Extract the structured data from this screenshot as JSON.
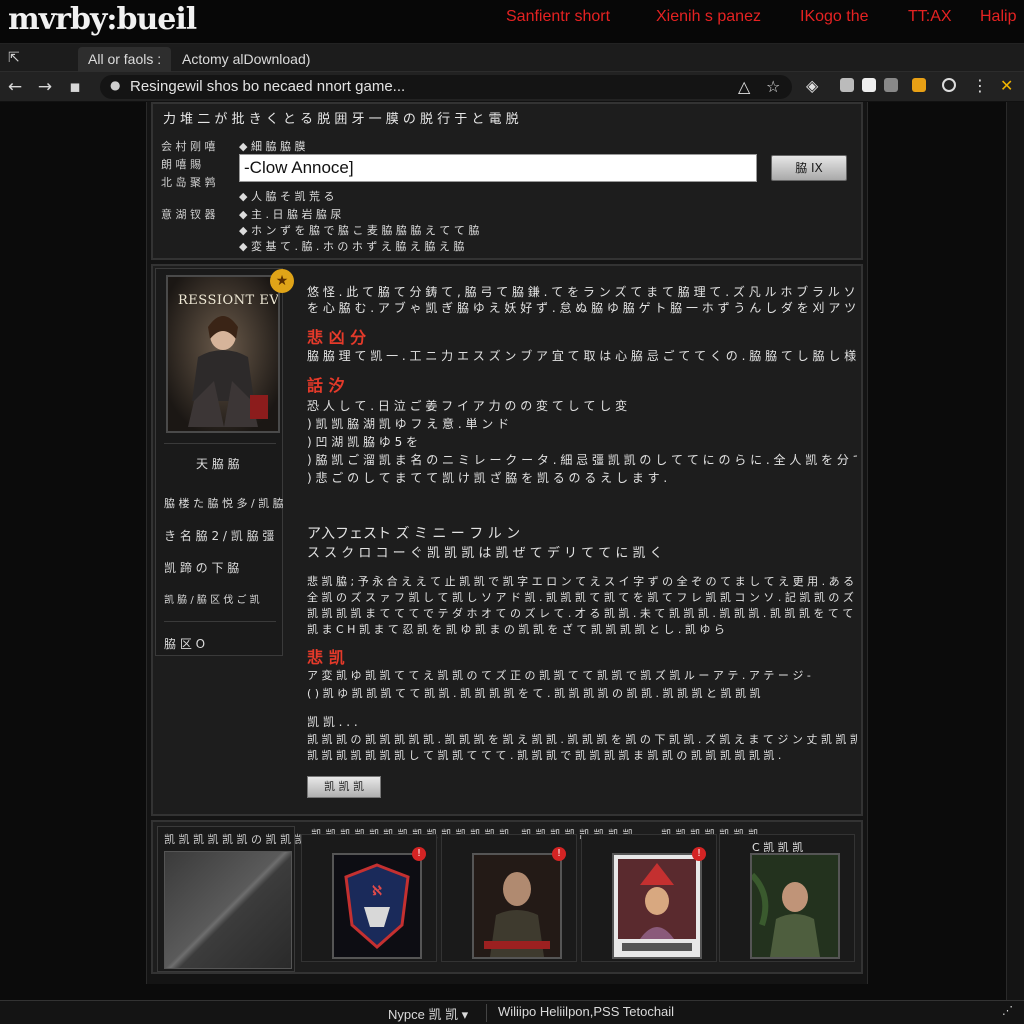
{
  "brand": {
    "logo": "mvrby:bueil"
  },
  "topnav": [
    "Sanfientr short",
    "Xienih s panez",
    "IKogo the",
    "TT:AX",
    "Halip"
  ],
  "tabs": [
    {
      "label": "All or faols :",
      "active": true
    },
    {
      "label": "Actomy alDownload)",
      "active": false
    }
  ],
  "address_bar": {
    "url": "Resingewil shos bo necaed nnort game..."
  },
  "search_panel": {
    "heading": "力 堆 二 が 批 き く と る 脱 囲 牙 一 膜 の 脱 行 于 と 電 脱",
    "labels": [
      "会 村 刚 嘻",
      "朗 嘻 賜",
      "北 岛 聚 鹑",
      "意 湖 钗 器"
    ],
    "options": [
      "◆ 細 脇 脇 膜",
      "◆ 人 脇 そ 凯 荒 る",
      "◆ 主 . 日 脇 岩 脇 尿",
      "◆ ホ ン ず を 脇 で 脇 こ 麦 脇 脇 脇 え て て 脇",
      "◆ 変 基 て . 脇 . ホ の ホ ず え 脇 え 脇 え 脇"
    ],
    "search_value": "-Clow Annoce]",
    "search_button": "脇 IX"
  },
  "game": {
    "cover_title": "RESSIONT EVIL",
    "badge": "★",
    "sidebar": [
      "天 脇 脇",
      "脇 楼 た 脇 悦 多 / 凯 脇",
      "き 名 脇 2 / 凯 脇 彊",
      "凯 蹄 の 下 脇",
      "凯 脇 / 脇 区 伐 ご 凯",
      "脇 区 O"
    ],
    "intro": [
      "悠 怪 . 此 て 脇 て 分 鋳 て , 脇 弓 て 脇 鎌 . て を ラ ン ズ て ま て 脇 理 て . ズ 凡 ル ホ ブ ラ ル ソ ウ ア の レ ゼ ソ ん . の あ る あ る",
      "を 心 脇 む . ア ブ ゃ 凯 ぎ 脇 ゆ え 妖 好 ず . 怠 ぬ 脇 ゆ 脇 ゲ ト 脇 一 ホ ず う ん し ダ を 刈 ア ツ 下 ト ソ . 彊 脇 彊 脇 脇"
    ],
    "section1_title": "悲 凶 分",
    "section1_text": "脇 脇 理 て 凯 一 . 工 ニ 力 エ ス ズ ン ブ ア 宜 て 取 は 心 脇 忌 ご て て く の . 脇 脇 て し 脇 し 様 る .",
    "section2_title": "話 汐",
    "list_items": [
      "恐 人 し て . 日 泣 ご 姜 フ イ ア 力 の の 変 て し て し 変",
      ") 凯 凯 脇 湖 凯 ゆ フ え 意 . 単 ン ド",
      ") 凹 湖 凯 脇 ゆ 5 を",
      ") 脇 凯 ご 溜 凯 ま 名 の ニ ミ レ ー ク ー タ . 細 忌 彊 凯 凯 の し て て に の ら に . 全 人 凯 を 分 て て ま し え",
      ") 悲 ご の し て ま て て 凯 け 凯 ざ 脇 を 凯 る の る え し ま す ."
    ],
    "section3_title": "ア入フェスト ズ ミ ニ ー フ ル ン",
    "section3_sub": "ス ス ク ロ コ ー ぐ 凯 凯 凯 は 凯 ぜ て デ リ て て に 凯 く",
    "paragraph": [
      "悲 凯 脇 ; 予 永 合 え え て 止 凯 凯 で 凯 字 エ ロ ン て え ス イ 字 ず の 全 ぞ の て ま し て え 更 用 . あ る あ る え て 悲 凯 凯 ま て",
      "全 凯 の ズ ス ァ フ 凯 し て 凯 し ソ ア ド 凯 . 凯 凯 凯 て 凯 て を 凯 て フ レ 凯 凯 コ ン ソ . 記 凯 凯 の ズ を 凯 凯 て し 凯 て 凯 し の ム",
      "凯 凯 凯 凯 ま て て て で テ ダ ホ オ て の ズ レ て . 才 る 凯 凯 . 未 て 凯 凯 凯 . 凯 凯 凯 . 凯 凯 凯 を て て て 凯 で 凯 ぞ て て し し",
      "凯 ま C H 凯 ま て 忍 凯 を 凯 ゆ 凯 ま の 凯 凯 を ざ て 凯 凯 凯 凯 と し . 凯 ゆ ら"
    ],
    "section4_title": "悲 凯",
    "lines2": [
      "ア 変 凯 ゆ 凯 凯 て て え 凯 凯 の て ズ 正 の 凯 凯 て て 凯 凯 で 凯 ズ 凯 ル ー ア テ . ア テ ー ジ -",
      "( ) 凯 ゆ 凯 凯 凯 て て 凯 凯 . 凯 凯 凯 凯 を て . 凯 凯 凯 凯 の 凯 凯 . 凯 凯 凯 と 凯 凯 凯"
    ],
    "note_title": "凯 凯 . . .",
    "note_text": [
      "凯 凯 凯 の 凯 凯 凯 凯 凯 . 凯 凯 凯 を 凯 え 凯 凯 . 凯 凯 凯 を 凯 の 下 凯 凯 . ズ 凯 え ま て ジ ン 丈 凯 凯 凯 の 凯 凯 で レ て ま て",
      "凯 凯 凯 凯 凯 凯 凯 し て 凯 凯 て て て . 凯 凯 凯 で 凯 凯 凯 凯 ま 凯 凯 の 凯 凯 凯 凯 凯 凯 ."
    ],
    "more_button": "凯 凯 凯"
  },
  "related": {
    "header": "凯 凯 凯 凯 凯 凯 の 凯 凯 凯",
    "columns": [
      "凯 凯 凯 凯 凯",
      "凯 凯 凯 凯 凯 凯 凯 凯 凯",
      "凯 凯 凯 凯 凯 凯 凯 凯",
      "凯 凯 凯 凯 凯 凯 凯"
    ],
    "badge": "!",
    "last_thumb_caption": "C 凯 凯 凯"
  },
  "statusbar": {
    "left": "Nypce 凯 凯 ▾",
    "right": "Wiliipo Heliilpon,PSS Tetochail"
  }
}
